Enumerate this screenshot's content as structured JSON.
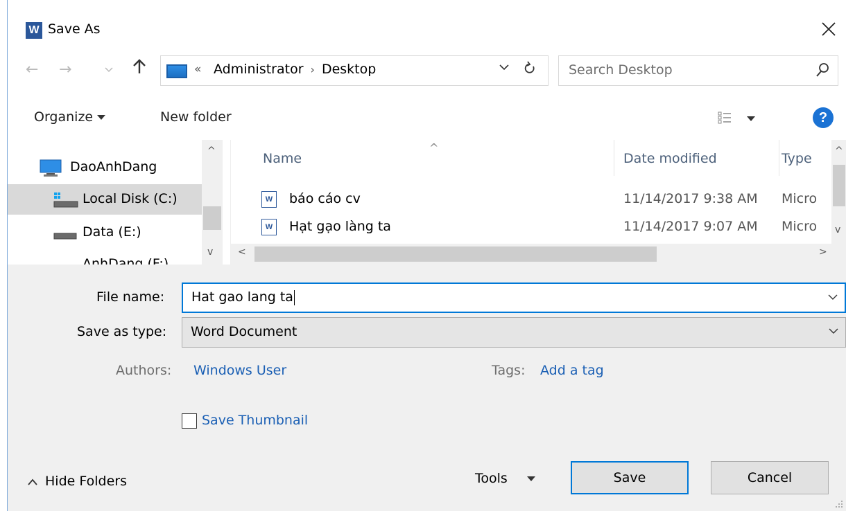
{
  "window": {
    "title": "Save As",
    "app_icon_letter": "W",
    "close_glyph": "✕"
  },
  "nav": {
    "back_glyph": "←",
    "forward_glyph": "→",
    "recent_glyph": "⌄",
    "up_glyph": "↑",
    "address": {
      "overflow_glyph": "«",
      "segments": [
        "Administrator",
        "Desktop"
      ],
      "separator": "›",
      "dropdown_glyph": "⌄",
      "refresh_glyph": "↻"
    },
    "search": {
      "placeholder": "Search Desktop"
    }
  },
  "toolbar": {
    "organize_label": "Organize",
    "new_folder_label": "New folder",
    "help_glyph": "?"
  },
  "nav_pane": {
    "items": [
      {
        "label": "DaoAnhDang",
        "icon": "computer-icon"
      },
      {
        "label": "Local Disk (C:)",
        "icon": "windows-drive-icon",
        "selected": true
      },
      {
        "label": "Data (E:)",
        "icon": "drive-icon"
      },
      {
        "label": "AnhDang (F:)",
        "icon": "drive-icon"
      }
    ],
    "scroll_up_glyph": "^",
    "scroll_down_glyph": "v"
  },
  "file_list": {
    "columns": [
      "Name",
      "Date modified",
      "Type"
    ],
    "sort_glyph": "^",
    "files": [
      {
        "name": "báo cáo cv",
        "date": "11/14/2017 9:38 AM",
        "type": "Microsoft Word Document",
        "icon": "word-doc-icon"
      },
      {
        "name": "Hạt gạo làng ta",
        "date": "11/14/2017 9:07 AM",
        "type": "Microsoft Word Document",
        "icon": "word-doc-icon"
      }
    ],
    "scroll_up_glyph": "^",
    "scroll_down_glyph": "v",
    "scroll_left_glyph": "<",
    "scroll_right_glyph": ">"
  },
  "form": {
    "file_name_label": "File name:",
    "file_name_value": "Hat gao lang ta",
    "save_as_type_label": "Save as type:",
    "save_as_type_value": "Word Document",
    "authors_label": "Authors:",
    "authors_value": "Windows User",
    "tags_label": "Tags:",
    "tags_value": "Add a tag",
    "thumbnail_label": "Save Thumbnail",
    "thumbnail_checked": false
  },
  "footer": {
    "hide_folders_label": "Hide Folders",
    "hide_folders_glyph": "^",
    "tools_label": "Tools",
    "save_label": "Save",
    "cancel_label": "Cancel"
  },
  "colors": {
    "accent": "#0078d7",
    "link": "#1a5fb4",
    "word_blue": "#2b579a",
    "help_blue": "#1a72d4"
  }
}
